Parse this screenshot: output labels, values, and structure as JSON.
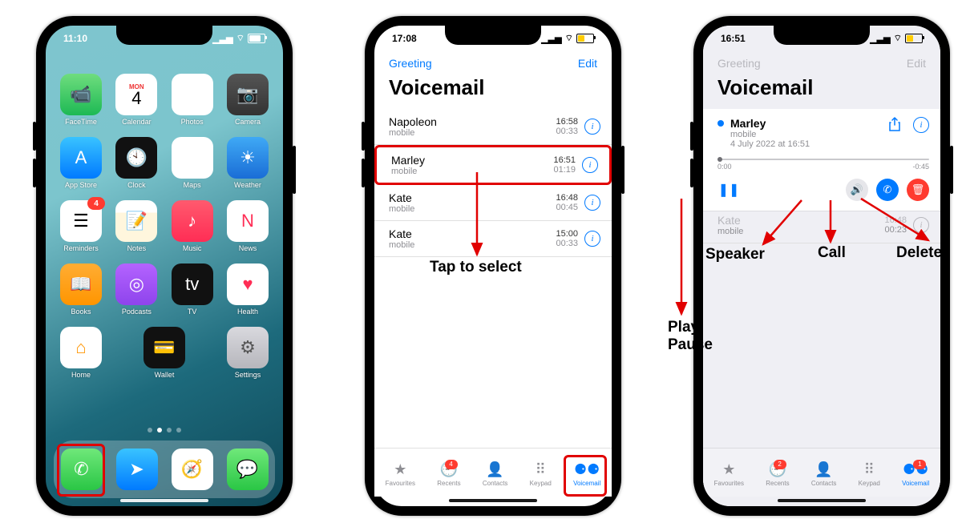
{
  "phone1": {
    "time": "11:10",
    "calendar": {
      "dow": "MON",
      "day": "4"
    },
    "apps": [
      [
        {
          "n": "FaceTime",
          "cls": "c-facetime",
          "g": "📹"
        },
        {
          "n": "Calendar",
          "cls": "c-calendar",
          "g": ""
        },
        {
          "n": "Photos",
          "cls": "c-photos",
          "g": "✿"
        },
        {
          "n": "Camera",
          "cls": "c-camera",
          "g": "📷"
        }
      ],
      [
        {
          "n": "App Store",
          "cls": "c-appstore",
          "g": "A"
        },
        {
          "n": "Clock",
          "cls": "c-clock",
          "g": "🕙"
        },
        {
          "n": "Maps",
          "cls": "c-maps",
          "g": "➤"
        },
        {
          "n": "Weather",
          "cls": "c-weather",
          "g": "☀"
        }
      ],
      [
        {
          "n": "Reminders",
          "cls": "c-reminders",
          "g": "☰",
          "badge": "4"
        },
        {
          "n": "Notes",
          "cls": "c-notes",
          "g": "📝"
        },
        {
          "n": "Music",
          "cls": "c-music",
          "g": "♪"
        },
        {
          "n": "News",
          "cls": "c-news",
          "g": "N"
        }
      ],
      [
        {
          "n": "Books",
          "cls": "c-books",
          "g": "📖"
        },
        {
          "n": "Podcasts",
          "cls": "c-podcasts",
          "g": "◎"
        },
        {
          "n": "TV",
          "cls": "c-tv",
          "g": "tv"
        },
        {
          "n": "Health",
          "cls": "c-health",
          "g": "♥"
        }
      ],
      [
        {
          "n": "Home",
          "cls": "c-home",
          "g": "⌂"
        },
        {
          "n": "Wallet",
          "cls": "c-wallet",
          "g": "💳"
        },
        {
          "n": "Settings",
          "cls": "c-settings",
          "g": "⚙"
        }
      ]
    ],
    "dock": [
      {
        "n": "Phone",
        "cls": "c-phone",
        "g": "✆"
      },
      {
        "n": "Arrow",
        "cls": "c-arrow",
        "g": "➤"
      },
      {
        "n": "Safari",
        "cls": "c-safari",
        "g": "🧭"
      },
      {
        "n": "Messages",
        "cls": "c-msg",
        "g": "💬"
      }
    ]
  },
  "phone2": {
    "time": "17:08",
    "nav": {
      "greeting": "Greeting",
      "edit": "Edit"
    },
    "title": "Voicemail",
    "voicemails": [
      {
        "name": "Napoleon",
        "sub": "mobile",
        "time": "16:58",
        "dur": "00:33"
      },
      {
        "name": "Marley",
        "sub": "mobile",
        "time": "16:51",
        "dur": "01:19"
      },
      {
        "name": "Kate",
        "sub": "mobile",
        "time": "16:48",
        "dur": "00:45"
      },
      {
        "name": "Kate",
        "sub": "mobile",
        "time": "15:00",
        "dur": "00:33"
      }
    ],
    "tabs": [
      {
        "n": "Favourites",
        "g": "★"
      },
      {
        "n": "Recents",
        "g": "🕘",
        "badge": "4"
      },
      {
        "n": "Contacts",
        "g": "👤"
      },
      {
        "n": "Keypad",
        "g": "⠿"
      },
      {
        "n": "Voicemail",
        "g": "⚈⚈",
        "on": true
      }
    ]
  },
  "phone3": {
    "time": "16:51",
    "nav": {
      "greeting": "Greeting",
      "edit": "Edit"
    },
    "title": "Voicemail",
    "expanded": {
      "name": "Marley",
      "sub": "mobile",
      "date": "4 July 2022 at 16:51",
      "pos": "0:00",
      "rem": "-0:45"
    },
    "below": {
      "name": "Kate",
      "sub": "mobile",
      "time": "16:48",
      "dur": "00:23"
    },
    "tabs": [
      {
        "n": "Favourites",
        "g": "★"
      },
      {
        "n": "Recents",
        "g": "🕘",
        "badge": "2"
      },
      {
        "n": "Contacts",
        "g": "👤"
      },
      {
        "n": "Keypad",
        "g": "⠿"
      },
      {
        "n": "Voicemail",
        "g": "⚈⚈",
        "on": true,
        "badge": "1"
      }
    ]
  },
  "annotations": {
    "tap": "Tap to select",
    "speaker": "Speaker",
    "call": "Call",
    "delete": "Delete",
    "playpause1": "Play",
    "playpause2": "Pause"
  }
}
